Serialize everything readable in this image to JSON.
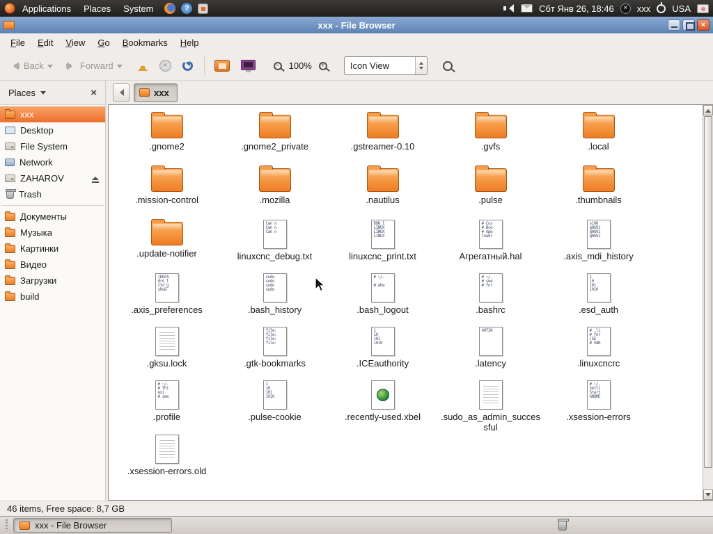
{
  "panel": {
    "menus": [
      "Applications",
      "Places",
      "System"
    ],
    "clock": "Сбт Янв 26, 18:46",
    "user": "xxx",
    "keyboard_layout": "USA"
  },
  "window": {
    "title": "xxx - File Browser"
  },
  "menubar": {
    "items": [
      "File",
      "Edit",
      "View",
      "Go",
      "Bookmarks",
      "Help"
    ]
  },
  "toolbar": {
    "back_label": "Back",
    "forward_label": "Forward",
    "zoom_level": "100%",
    "view_mode": "Icon View"
  },
  "pathbar": {
    "current": "xxx"
  },
  "sidebar": {
    "title": "Places",
    "items": [
      {
        "label": "xxx",
        "icon": "home",
        "selected": true
      },
      {
        "label": "Desktop",
        "icon": "desktop"
      },
      {
        "label": "File System",
        "icon": "filesystem"
      },
      {
        "label": "Network",
        "icon": "network"
      },
      {
        "label": "ZAHAROV",
        "icon": "drive",
        "eject": true
      },
      {
        "label": "Trash",
        "icon": "trash"
      },
      {
        "label": "Документы",
        "icon": "folder",
        "separator_before": true
      },
      {
        "label": "Музыка",
        "icon": "folder"
      },
      {
        "label": "Картинки",
        "icon": "folder"
      },
      {
        "label": "Видео",
        "icon": "folder"
      },
      {
        "label": "Загрузки",
        "icon": "folder"
      },
      {
        "label": "build",
        "icon": "folder"
      }
    ]
  },
  "files": [
    {
      "name": ".gnome2",
      "icon": "folder"
    },
    {
      "name": ".gnome2_private",
      "icon": "folder"
    },
    {
      "name": ".gstreamer-0.10",
      "icon": "folder"
    },
    {
      "name": ".gvfs",
      "icon": "folder"
    },
    {
      "name": ".local",
      "icon": "folder"
    },
    {
      "name": ".mission-control",
      "icon": "folder"
    },
    {
      "name": ".mozilla",
      "icon": "folder"
    },
    {
      "name": ".nautilus",
      "icon": "folder"
    },
    {
      "name": ".pulse",
      "icon": "folder"
    },
    {
      "name": ".thumbnails",
      "icon": "folder"
    },
    {
      "name": ".update-notifier",
      "icon": "folder"
    },
    {
      "name": "linuxcnc_debug.txt",
      "icon": "text",
      "preview": [
        "Can n",
        "Can n",
        "Can n"
      ]
    },
    {
      "name": "linuxcnc_print.txt",
      "icon": "text",
      "preview": [
        "RUN_I",
        "LINUX",
        "LINUX",
        "LINUX"
      ]
    },
    {
      "name": "Агрегатный.hal",
      "icon": "text",
      "preview": [
        "# Соз",
        "# Все",
        "# при",
        "loadr"
      ]
    },
    {
      "name": ".axis_mdi_history",
      "icon": "text",
      "preview": [
        "s100",
        "g0G91",
        "g0G91",
        "g0G91"
      ]
    },
    {
      "name": ".axis_preferences",
      "icon": "text",
      "preview": [
        "[DEFA",
        "dro_l",
        "tto_g",
        "show"
      ]
    },
    {
      "name": ".bash_history",
      "icon": "text",
      "preview": [
        "sudo",
        "sudo",
        "sudo",
        "sudo"
      ]
    },
    {
      "name": ".bash_logout",
      "icon": "text",
      "preview": [
        "# ~/.",
        "",
        "# whe"
      ]
    },
    {
      "name": ".bashrc",
      "icon": "text",
      "preview": [
        "# ~/.",
        "# see",
        "# for"
      ]
    },
    {
      "name": ".esd_auth",
      "icon": "text",
      "preview": [
        "1",
        "10",
        "101",
        "1010"
      ]
    },
    {
      "name": ".gksu.lock",
      "icon": "text",
      "preview": []
    },
    {
      "name": ".gtk-bookmarks",
      "icon": "text",
      "preview": [
        "file:",
        "file:",
        "file:",
        "file:"
      ]
    },
    {
      "name": ".ICEauthority",
      "icon": "text",
      "preview": [
        "1",
        "10",
        "101",
        "1010"
      ]
    },
    {
      "name": ".latency",
      "icon": "text",
      "preview": [
        "40738"
      ]
    },
    {
      "name": ".linuxcncrc",
      "icon": "text",
      "preview": [
        "# .li",
        "# for",
        "[SE",
        "# VAR"
      ]
    },
    {
      "name": ".profile",
      "icon": "text",
      "preview": [
        "# ~/.",
        "# Thi",
        "exi",
        "# see"
      ]
    },
    {
      "name": ".pulse-cookie",
      "icon": "text",
      "preview": [
        "1",
        "10",
        "101",
        "1010"
      ]
    },
    {
      "name": ".recently-used.xbel",
      "icon": "globe",
      "preview": []
    },
    {
      "name": ".sudo_as_admin_successful",
      "icon": "text",
      "preview": []
    },
    {
      "name": ".xsession-errors",
      "icon": "text",
      "preview": [
        "# ~/.",
        "Setti",
        "Start",
        "GNOME"
      ]
    },
    {
      "name": ".xsession-errors.old",
      "icon": "text",
      "preview": []
    }
  ],
  "statusbar": {
    "text": "46 items, Free space: 8,7 GB"
  },
  "taskbar": {
    "active_window": "xxx - File Browser"
  }
}
